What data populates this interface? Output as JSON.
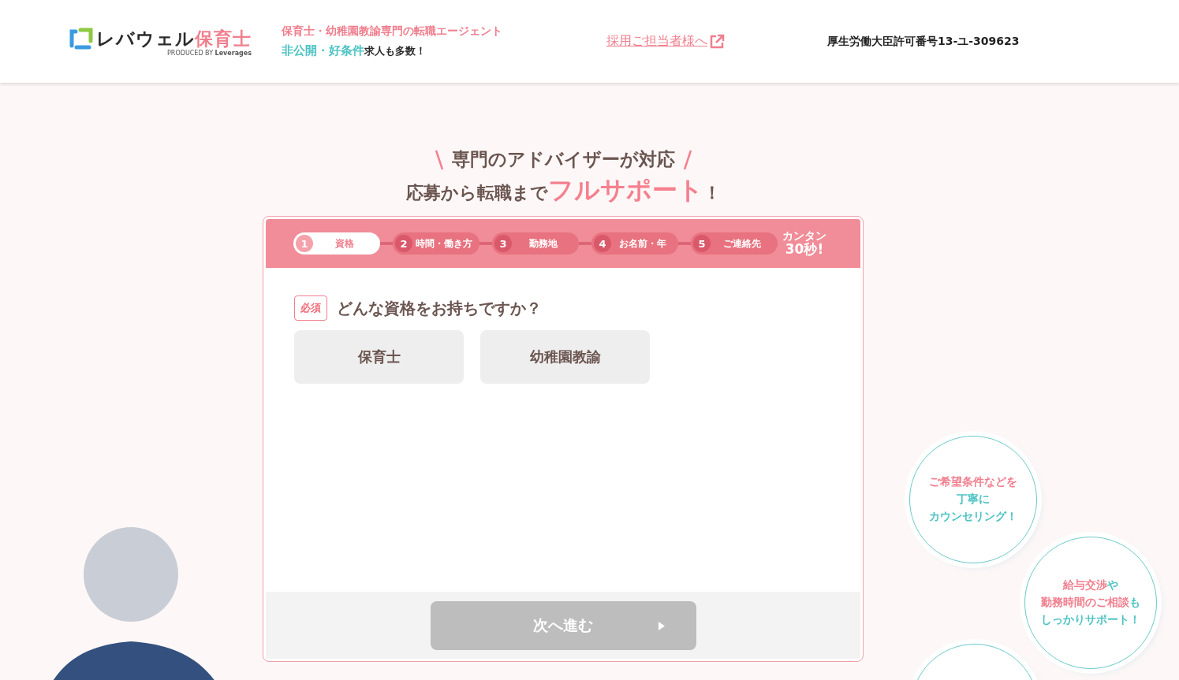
{
  "header": {
    "logo": {
      "parts": [
        {
          "text": "レバウェル",
          "kind": "dark"
        },
        {
          "text": "保育士",
          "kind": "pink"
        }
      ],
      "byline": "PRODUCED BY **Leverages**"
    },
    "tagline": [
      [
        {
          "text": "保育士・幼稚園教諭専門の転職エージェント",
          "kind": "pink"
        }
      ],
      [
        {
          "text": "非公開・好条件",
          "kind": "teal"
        },
        {
          "text": "求人も多数！",
          "kind": "dark"
        }
      ]
    ],
    "employer_link": "採用ご担当者様へ",
    "license": "厚生労働大臣許可番号13-ユ-309623"
  },
  "headline": {
    "line_1": "専門のアドバイザーが対応",
    "line_2": [
      {
        "text": "応募から転職まで",
        "kind": "dark"
      },
      {
        "text": "フルサポート",
        "kind": "big"
      },
      {
        "text": "！",
        "kind": "dark"
      }
    ]
  },
  "form": {
    "steps": [
      {
        "number": "1",
        "label": "資格",
        "selected": true
      },
      {
        "number": "2",
        "label": "時間・働き方",
        "selected": false
      },
      {
        "number": "3",
        "label": "勤務地",
        "selected": false
      },
      {
        "number": "4",
        "label": "お名前・年",
        "selected": false
      },
      {
        "number": "5",
        "label": "ご連絡先",
        "selected": false
      }
    ],
    "duration": {
      "line_1": "カンタン",
      "line_2": "30秒!"
    },
    "required_badge": "必須",
    "question": "どんな資格をお持ちですか？",
    "options": [
      {
        "label": "保育士",
        "selected": false
      },
      {
        "label": "幼稚園教諭",
        "selected": false
      }
    ],
    "next_button": {
      "label": "次へ進む",
      "disabled": true
    }
  },
  "bubbles": [
    {
      "lines": [
        [
          {
            "text": "ご希望条件などを",
            "kind": "pink"
          }
        ],
        [
          {
            "text": "丁寧に",
            "kind": "teal"
          }
        ],
        [
          {
            "text": "カウンセリング！",
            "kind": "teal"
          }
        ]
      ]
    },
    {
      "lines": [
        [
          {
            "text": "給与交渉",
            "kind": "pink"
          },
          {
            "text": "や",
            "kind": "teal"
          }
        ],
        [
          {
            "text": "勤務時間のご相談",
            "kind": "pink"
          },
          {
            "text": "も",
            "kind": "teal"
          }
        ],
        [
          {
            "text": "しっかりサポート！",
            "kind": "teal"
          }
        ]
      ]
    }
  ]
}
